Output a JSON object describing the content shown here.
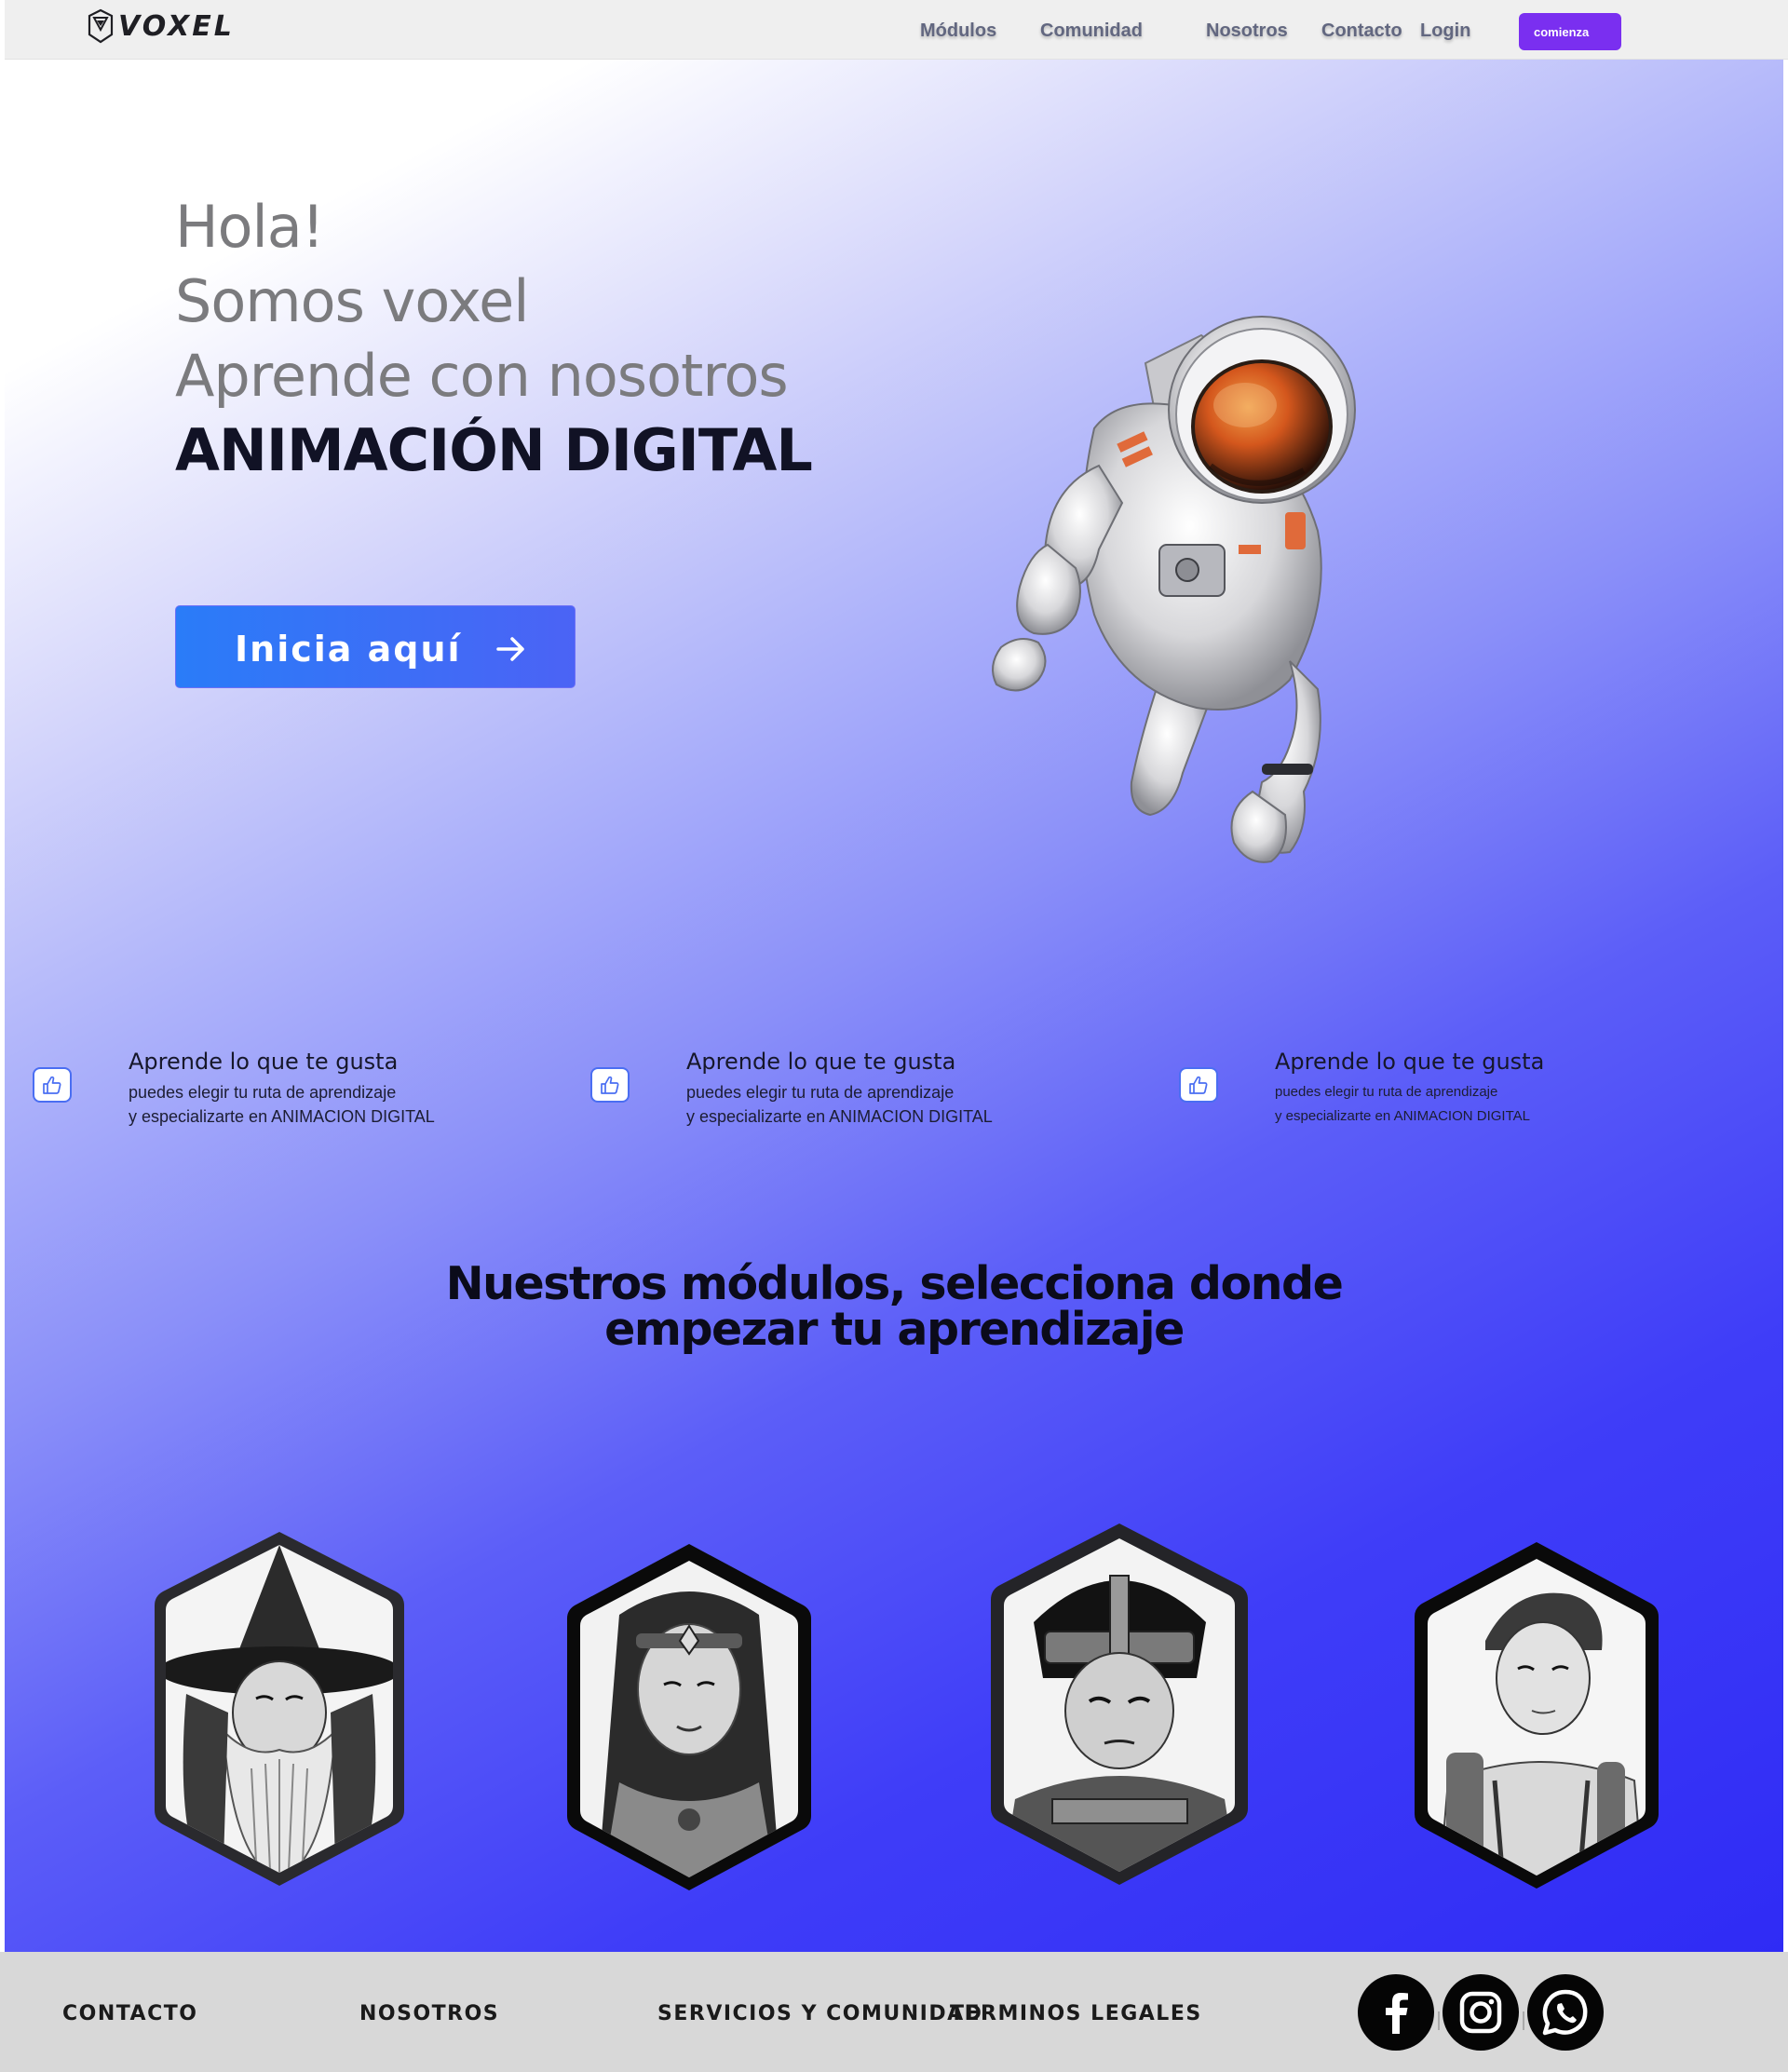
{
  "brand": {
    "name": "VOXEL"
  },
  "nav": {
    "links": [
      "Módulos",
      "Comunidad",
      "Nosotros",
      "Contacto",
      "Login"
    ],
    "cta": "comienza"
  },
  "hero": {
    "lines": [
      "Hola!",
      "Somos voxel",
      "Aprende con nosotros"
    ],
    "highlight": "ANIMACIÓN DIGITAL",
    "button": "Inicia aquí"
  },
  "features": [
    {
      "title": "Aprende lo que te gusta",
      "line1": "puedes elegir tu ruta de aprendizaje",
      "line2": "y especializarte en ANIMACION DIGITAL"
    },
    {
      "title": "Aprende lo que te gusta",
      "line1": "puedes elegir tu ruta de aprendizaje",
      "line2": "y especializarte en ANIMACION DIGITAL"
    },
    {
      "title": "Aprende lo que te gusta",
      "line1": "puedes elegir tu ruta de aprendizaje",
      "line2": "y especializarte en ANIMACION DIGITAL"
    }
  ],
  "modules": {
    "title_line1": "Nuestros módulos, selecciona donde",
    "title_line2": "empezar tu aprendizaje",
    "cards": [
      "wizard-portrait",
      "warrior-woman-portrait",
      "gladiator-portrait",
      "explorer-boy-portrait"
    ]
  },
  "footer": {
    "links": [
      "CONTACTO",
      "NOSOTROS",
      "SERVICIOS  Y COMUNIDAD",
      "TERMINOS LEGALES"
    ],
    "social": [
      "facebook-icon",
      "instagram-icon",
      "whatsapp-icon"
    ]
  },
  "colors": {
    "accent": "#7a2ff0",
    "cta_blue": "#2a7cf8",
    "gradient_end": "#2f2bf5",
    "footer_bg": "#d8d8d8"
  }
}
